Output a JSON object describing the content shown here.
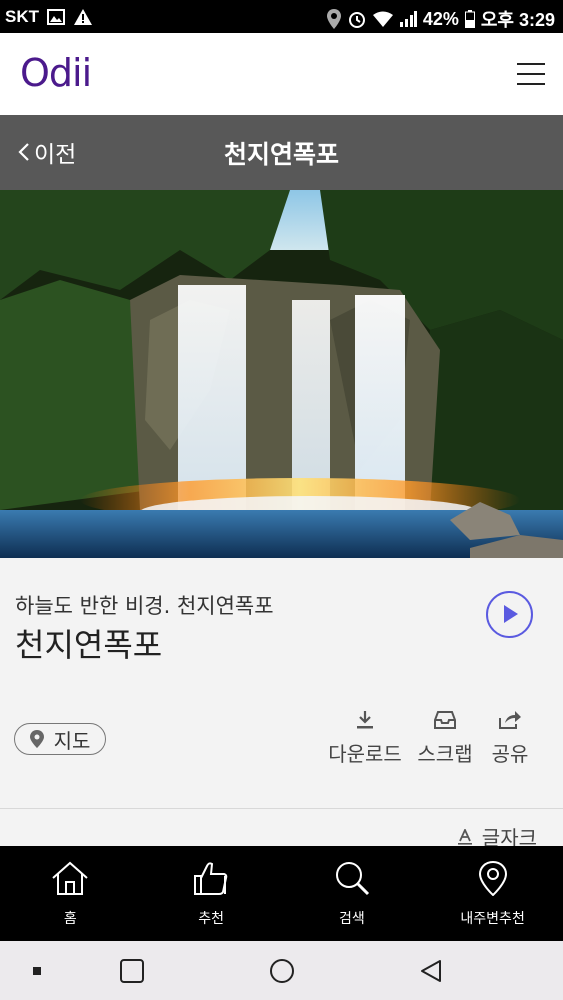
{
  "status_bar": {
    "carrier": "SKT",
    "battery": "42%",
    "time": "오후 3:29"
  },
  "header": {
    "logo": "Odii",
    "menu_icon": "hamburger-icon"
  },
  "nav": {
    "back_label": "이전",
    "title": "천지연폭포"
  },
  "content": {
    "subtitle": "하늘도 반한 비경. 천지연폭포",
    "title": "천지연폭포",
    "map_label": "지도",
    "actions": [
      {
        "label": "다운로드",
        "icon": "download-icon"
      },
      {
        "label": "스크랩",
        "icon": "inbox-icon"
      },
      {
        "label": "공유",
        "icon": "share-icon"
      }
    ],
    "font_size_label": "글자크"
  },
  "tabs": [
    {
      "label": "홈",
      "icon": "home-icon"
    },
    {
      "label": "추천",
      "icon": "thumbs-up-icon"
    },
    {
      "label": "검색",
      "icon": "search-icon"
    },
    {
      "label": "내주변추천",
      "icon": "location-pin-icon"
    }
  ],
  "colors": {
    "accent": "#4b1a8c",
    "play": "#5a5ae0",
    "navbar": "#585858"
  }
}
